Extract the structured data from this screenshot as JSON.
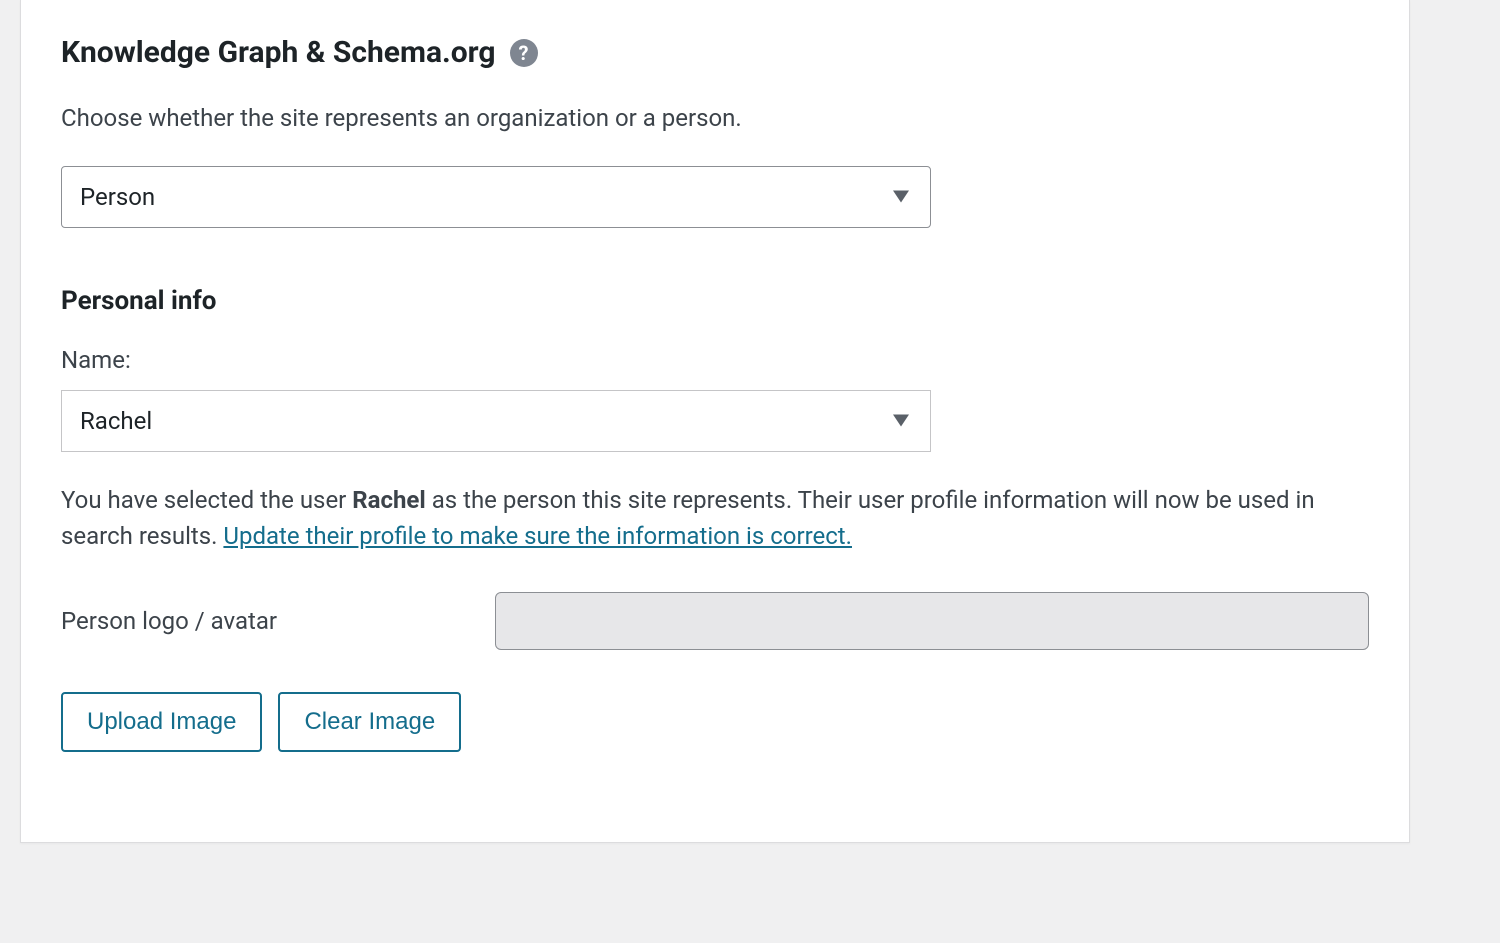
{
  "header": {
    "title": "Knowledge Graph & Schema.org"
  },
  "intro": {
    "helper": "Choose whether the site represents an organization or a person."
  },
  "entity_select": {
    "value": "Person"
  },
  "personal_section": {
    "title": "Personal info",
    "name_label": "Name:",
    "name_value": "Rachel",
    "info_prefix": "You have selected the user ",
    "info_name": "Rachel",
    "info_mid": " as the person this site represents. Their user profile information will now be used in search results. ",
    "info_link": "Update their profile to make sure the information is correct.",
    "avatar_label": "Person logo / avatar"
  },
  "buttons": {
    "upload": "Upload Image",
    "clear": "Clear Image"
  }
}
